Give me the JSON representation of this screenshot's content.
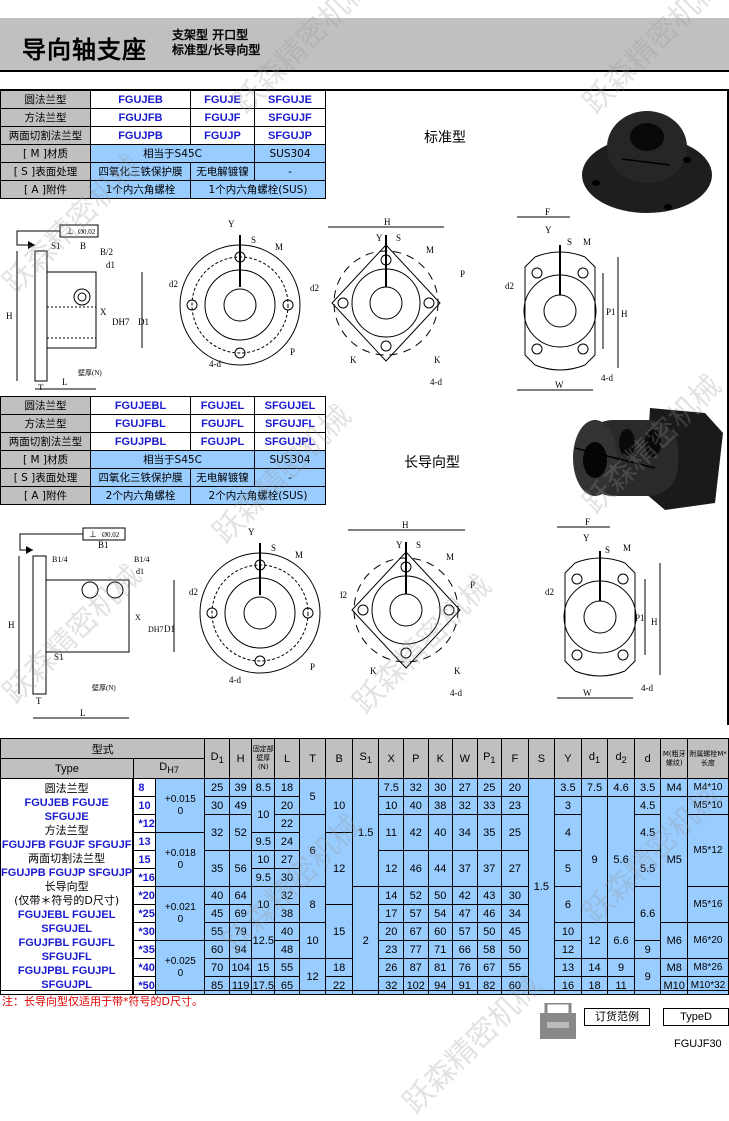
{
  "header": {
    "title": "导向轴支座",
    "subtitle_line1": "支架型  开口型",
    "subtitle_line2": "标准型/长导向型"
  },
  "standard": {
    "label": "标准型",
    "spec_table": {
      "rows": [
        {
          "label": "圆法兰型",
          "codes": [
            "FGUJEB",
            "FGUJE",
            "SFGUJE"
          ]
        },
        {
          "label": "方法兰型",
          "codes": [
            "FGUJFB",
            "FGUJF",
            "SFGUJF"
          ]
        },
        {
          "label": "两面切割法兰型",
          "codes": [
            "FGUJPB",
            "FGUJP",
            "SFGUJP"
          ]
        }
      ],
      "material": {
        "label": "[ M ]材质",
        "steel": "相当于S45C",
        "stainless": "SUS304"
      },
      "surface": {
        "label": "[ S ]表面处理",
        "oxide": "四氧化三铁保护膜",
        "nickel": "无电解镀镍",
        "none": "-"
      },
      "accessory": {
        "label": "[ A ]附件",
        "steel": "1个内六角螺栓",
        "stainless": "1个内六角螺栓(SUS)"
      }
    }
  },
  "long": {
    "label": "长导向型",
    "spec_table": {
      "rows": [
        {
          "label": "圆法兰型",
          "codes": [
            "FGUJEBL",
            "FGUJEL",
            "SFGUJEL"
          ]
        },
        {
          "label": "方法兰型",
          "codes": [
            "FGUJFBL",
            "FGUJFL",
            "SFGUJFL"
          ]
        },
        {
          "label": "两面切割法兰型",
          "codes": [
            "FGUJPBL",
            "FGUJPL",
            "SFGUJPL"
          ]
        }
      ],
      "material": {
        "label": "[ M ]材质",
        "steel": "相当于S45C",
        "stainless": "SUS304"
      },
      "surface": {
        "label": "[ S ]表面处理",
        "oxide": "四氧化三铁保护膜",
        "nickel": "无电解镀镍",
        "none": "-"
      },
      "accessory": {
        "label": "[ A ]附件",
        "steel": "2个内六角螺栓",
        "stainless": "2个内六角螺栓(SUS)"
      }
    }
  },
  "drawing_labels": {
    "flatness": "⊥",
    "tolerance": "Ø0.02",
    "S1": "S1",
    "B": "B",
    "B_half": "B/2",
    "d1": "d1",
    "X": "X",
    "DH7": "DH7",
    "D1": "D1",
    "H": "H",
    "T": "T",
    "L": "L",
    "N": "壁厚(N)",
    "B1": "B1",
    "B1_quarter": "B1/4",
    "Y": "Y",
    "S": "S",
    "M": "M",
    "d2": "d2",
    "P": "P",
    "K": "K",
    "F": "F",
    "P1": "P1",
    "W": "W",
    "4d": "4-d"
  },
  "dims_table": {
    "headers": {
      "type_group": "型式",
      "type": "Type",
      "D": "DH7",
      "cols": [
        "D1",
        "H",
        "固定部壁厚(N)",
        "L",
        "T",
        "B",
        "S1",
        "X",
        "P",
        "K",
        "W",
        "P1",
        "F",
        "S",
        "Y",
        "d1",
        "d2",
        "d",
        "M(粗牙螺纹)",
        "附属螺栓M*长度"
      ]
    },
    "type_text": [
      {
        "cn": "圆法兰型"
      },
      {
        "en": "FGUJEB FGUJE SFGUJE"
      },
      {
        "cn": "方法兰型"
      },
      {
        "en": "FGUJFB FGUJF SFGUJF"
      },
      {
        "cn": "两面切割法兰型"
      },
      {
        "en": "FGUJPB FGUJP SFGUJP"
      },
      {
        "cn": "长导向型"
      },
      {
        "cn": "(仅带＊符号的D尺寸)"
      },
      {
        "en": "FGUJEBL FGUJEL"
      },
      {
        "en": "SFGUJEL"
      },
      {
        "en": "FGUJFBL FGUJFL"
      },
      {
        "en": "SFGUJFL"
      },
      {
        "en": "FGUJPBL FGUJPL"
      },
      {
        "en": "SFGUJPL"
      }
    ],
    "rows": [
      {
        "D": "8",
        "tol": "+0.015 / 0",
        "D1": "25",
        "H": "39",
        "N": "8.5",
        "L": "18",
        "T": "5",
        "B": "10",
        "S1": "1.5",
        "X": "7.5",
        "P": "32",
        "K": "30",
        "W": "27",
        "P1": "25",
        "F": "20",
        "S": "1.5",
        "Y": "3.5",
        "d1": "7.5",
        "d2": "4.6",
        "d": "3.5",
        "M": "M4",
        "bolt": "M4*10"
      },
      {
        "D": "10",
        "tol": "+0.015 / 0",
        "D1": "30",
        "H": "49",
        "N": "10",
        "L": "20",
        "T": "5",
        "B": "10",
        "S1": "1.5",
        "X": "10",
        "P": "40",
        "K": "38",
        "W": "32",
        "P1": "33",
        "F": "23",
        "S": "1.5",
        "Y": "3",
        "d1": "9",
        "d2": "5.6",
        "d": "4.5",
        "M": "M5",
        "bolt": "M5*10"
      },
      {
        "D": "*12",
        "tol": "+0.015 / 0",
        "D1": "32",
        "H": "52",
        "N": "10",
        "L": "22",
        "T": "6",
        "B": "10",
        "S1": "1.5",
        "X": "11",
        "P": "42",
        "K": "40",
        "W": "34",
        "P1": "35",
        "F": "25",
        "S": "1.5",
        "Y": "4",
        "d1": "9",
        "d2": "5.6",
        "d": "4.5",
        "M": "M5",
        "bolt": "M5*12"
      },
      {
        "D": "13",
        "tol": "+0.018 / 0",
        "D1": "32",
        "H": "52",
        "N": "9.5",
        "L": "24",
        "T": "6",
        "B": "12",
        "S1": "1.5",
        "X": "11",
        "P": "42",
        "K": "40",
        "W": "34",
        "P1": "35",
        "F": "25",
        "S": "1.5",
        "Y": "4",
        "d1": "9",
        "d2": "5.6",
        "d": "4.5",
        "M": "M5",
        "bolt": "M5*12"
      },
      {
        "D": "15",
        "tol": "+0.018 / 0",
        "D1": "35",
        "H": "56",
        "N": "10",
        "L": "27",
        "T": "6",
        "B": "12",
        "S1": "1.5",
        "X": "12",
        "P": "46",
        "K": "44",
        "W": "37",
        "P1": "37",
        "F": "27",
        "S": "1.5",
        "Y": "5",
        "d1": "9",
        "d2": "5.6",
        "d": "5.5",
        "M": "M5",
        "bolt": "M5*12"
      },
      {
        "D": "*16",
        "tol": "+0.018 / 0",
        "D1": "35",
        "H": "56",
        "N": "9.5",
        "L": "30",
        "T": "6",
        "B": "12",
        "S1": "1.5",
        "X": "12",
        "P": "46",
        "K": "44",
        "W": "37",
        "P1": "37",
        "F": "27",
        "S": "1.5",
        "Y": "5",
        "d1": "9",
        "d2": "5.6",
        "d": "5.5",
        "M": "M5",
        "bolt": "M5*12"
      },
      {
        "D": "*20",
        "tol": "+0.021 / 0",
        "D1": "40",
        "H": "64",
        "N": "10",
        "L": "32",
        "T": "8",
        "B": "12",
        "S1": "2",
        "X": "14",
        "P": "52",
        "K": "50",
        "W": "42",
        "P1": "43",
        "F": "30",
        "S": "1.5",
        "Y": "6",
        "d1": "9",
        "d2": "5.6",
        "d": "6.6",
        "M": "M5",
        "bolt": "M5*16"
      },
      {
        "D": "*25",
        "tol": "+0.021 / 0",
        "D1": "45",
        "H": "69",
        "N": "10",
        "L": "38",
        "T": "8",
        "B": "15",
        "S1": "2",
        "X": "17",
        "P": "57",
        "K": "54",
        "W": "47",
        "P1": "46",
        "F": "34",
        "S": "1.5",
        "Y": "6",
        "d1": "9",
        "d2": "5.6",
        "d": "6.6",
        "M": "M5",
        "bolt": "M5*16"
      },
      {
        "D": "*30",
        "tol": "+0.021 / 0",
        "D1": "55",
        "H": "79",
        "N": "12.5",
        "L": "40",
        "T": "10",
        "B": "15",
        "S1": "2",
        "X": "20",
        "P": "67",
        "K": "60",
        "W": "57",
        "P1": "50",
        "F": "45",
        "S": "1.5",
        "Y": "10",
        "d1": "12",
        "d2": "6.6",
        "d": "6.6",
        "M": "M6",
        "bolt": "M6*20"
      },
      {
        "D": "*35",
        "tol": "+0.025 / 0",
        "D1": "60",
        "H": "94",
        "N": "12.5",
        "L": "48",
        "T": "10",
        "B": "15",
        "S1": "2",
        "X": "23",
        "P": "77",
        "K": "71",
        "W": "66",
        "P1": "58",
        "F": "50",
        "S": "1.5",
        "Y": "12",
        "d1": "12",
        "d2": "6.6",
        "d": "9",
        "M": "M6",
        "bolt": "M6*20"
      },
      {
        "D": "*40",
        "tol": "+0.025 / 0",
        "D1": "70",
        "H": "104",
        "N": "15",
        "L": "55",
        "T": "12",
        "B": "18",
        "S1": "2",
        "X": "26",
        "P": "87",
        "K": "81",
        "W": "76",
        "P1": "67",
        "F": "55",
        "S": "1.5",
        "Y": "13",
        "d1": "14",
        "d2": "9",
        "d": "9",
        "M": "M8",
        "bolt": "M8*26"
      },
      {
        "D": "*50",
        "tol": "+0.025 / 0",
        "D1": "85",
        "H": "119",
        "N": "17.5",
        "L": "65",
        "T": "12",
        "B": "22",
        "S1": "2",
        "X": "32",
        "P": "102",
        "K": "94",
        "W": "91",
        "P1": "82",
        "F": "60",
        "S": "1.5",
        "Y": "16",
        "d1": "18",
        "d2": "11",
        "d": "9",
        "M": "M10",
        "bolt": "M10*32"
      }
    ]
  },
  "note": "注：长导向型仅适用于带*符号的D尺寸。",
  "order": {
    "label": "订货范例",
    "type_label": "TypeD",
    "example": "FGUJF30"
  },
  "watermark": "跃森精密机械"
}
